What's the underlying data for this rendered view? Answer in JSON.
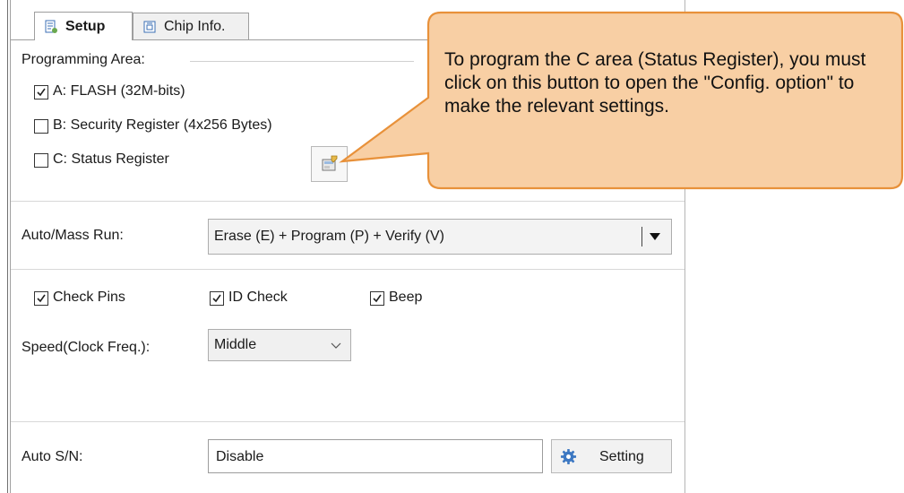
{
  "tabs": [
    {
      "label": "Setup",
      "active": true,
      "icon": "setup-icon"
    },
    {
      "label": "Chip Info.",
      "active": false,
      "icon": "chip-info-icon"
    }
  ],
  "programming_area": {
    "title": "Programming Area:",
    "items": [
      {
        "label": "A: FLASH (32M-bits)",
        "checked": true
      },
      {
        "label": "B: Security Register (4x256 Bytes)",
        "checked": false
      },
      {
        "label": "C: Status Register",
        "checked": false
      }
    ],
    "config_button_icon": "config-option-icon"
  },
  "callout": {
    "text": "To program the C area (Status Register), you must click on this button to open the \"Config. option\" to make the relevant settings.",
    "fill": "#f8cfa4",
    "border": "#e8913a"
  },
  "auto_mass_run": {
    "label": "Auto/Mass Run:",
    "value": "Erase (E) + Program (P) + Verify (V)"
  },
  "options": {
    "check_pins": {
      "label": "Check Pins",
      "checked": true
    },
    "id_check": {
      "label": "ID Check",
      "checked": true
    },
    "beep": {
      "label": "Beep",
      "checked": true
    }
  },
  "speed": {
    "label": "Speed(Clock Freq.):",
    "value": "Middle"
  },
  "auto_sn": {
    "label": "Auto S/N:",
    "value": "Disable",
    "button_label": "Setting",
    "button_icon": "gear-icon"
  }
}
